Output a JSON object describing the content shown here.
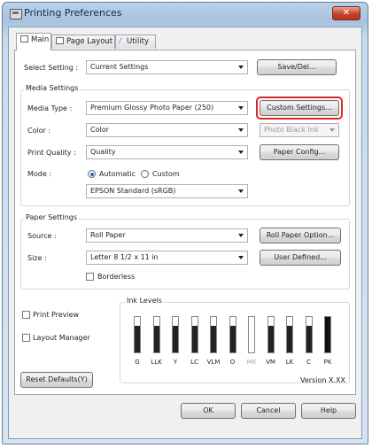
{
  "window": {
    "title": "Printing Preferences",
    "close_glyph": "✕"
  },
  "tabs": [
    {
      "label": "Main",
      "icon": "printer-icon"
    },
    {
      "label": "Page Layout",
      "icon": "page-icon"
    },
    {
      "label": "Utility",
      "icon": "wrench-icon"
    }
  ],
  "select_setting": {
    "label": "Select Setting :",
    "value": "Current Settings",
    "button": "Save/Del..."
  },
  "media_settings": {
    "title": "Media Settings",
    "media_type_label": "Media Type :",
    "media_type_value": "Premium Glossy Photo Paper (250)",
    "custom_settings_button": "Custom Settings...",
    "color_label": "Color :",
    "color_value": "Color",
    "black_ink_value": "Photo Black Ink",
    "print_quality_label": "Print Quality :",
    "print_quality_value": "Quality",
    "paper_config_button": "Paper Config...",
    "mode_label": "Mode :",
    "mode_automatic": "Automatic",
    "mode_custom": "Custom",
    "mode_selected": "Automatic",
    "mode_value": "EPSON Standard (sRGB)"
  },
  "paper_settings": {
    "title": "Paper Settings",
    "source_label": "Source :",
    "source_value": "Roll Paper",
    "roll_option_button": "Roll Paper Option...",
    "size_label": "Size :",
    "size_value": "Letter 8 1/2 x 11 in",
    "user_defined_button": "User Defined...",
    "borderless_label": "Borderless"
  },
  "options": {
    "print_preview": "Print Preview",
    "layout_manager": "Layout Manager"
  },
  "ink_levels": {
    "title": "Ink Levels",
    "inks": [
      {
        "label": "G",
        "level": 0.75,
        "color": "#222222",
        "disabled": false
      },
      {
        "label": "LLK",
        "level": 0.75,
        "color": "#222222",
        "disabled": false
      },
      {
        "label": "Y",
        "level": 0.75,
        "color": "#222222",
        "disabled": false
      },
      {
        "label": "LC",
        "level": 0.75,
        "color": "#222222",
        "disabled": false
      },
      {
        "label": "VLM",
        "level": 0.75,
        "color": "#222222",
        "disabled": false
      },
      {
        "label": "O",
        "level": 0.75,
        "color": "#222222",
        "disabled": false
      },
      {
        "label": "MK",
        "level": 0.0,
        "color": "#222222",
        "disabled": true
      },
      {
        "label": "VM",
        "level": 0.75,
        "color": "#222222",
        "disabled": false
      },
      {
        "label": "LK",
        "level": 0.75,
        "color": "#222222",
        "disabled": false
      },
      {
        "label": "C",
        "level": 0.75,
        "color": "#222222",
        "disabled": false
      },
      {
        "label": "PK",
        "level": 1.0,
        "color": "#111111",
        "disabled": false
      }
    ]
  },
  "footer": {
    "reset_button": "Reset Defaults(Y)",
    "version": "Version X.XX"
  },
  "dialog_buttons": {
    "ok": "OK",
    "cancel": "Cancel",
    "help": "Help"
  },
  "colors": {
    "highlight": "#e22525",
    "title_bar": "#b9d1ea"
  }
}
